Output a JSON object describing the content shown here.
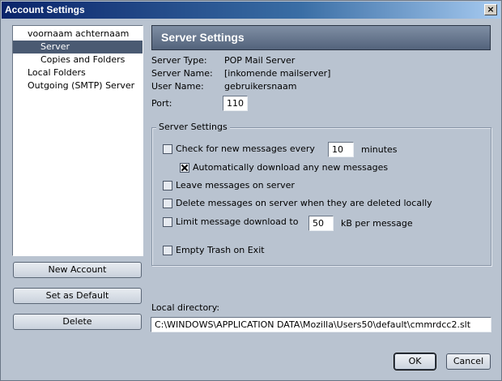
{
  "window": {
    "title": "Account Settings",
    "close_glyph": "×"
  },
  "tree": {
    "items": [
      {
        "label": "voornaam achternaam",
        "level": 0,
        "selected": false
      },
      {
        "label": "Server",
        "level": 1,
        "selected": true
      },
      {
        "label": "Copies and Folders",
        "level": 1,
        "selected": false
      },
      {
        "label": "Local Folders",
        "level": 0,
        "selected": false
      },
      {
        "label": "Outgoing (SMTP) Server",
        "level": 0,
        "selected": false
      }
    ]
  },
  "side_buttons": {
    "new_account": "New Account",
    "set_default": "Set as Default",
    "delete": "Delete"
  },
  "panel": {
    "title": "Server Settings",
    "server_type_label": "Server Type:",
    "server_type_value": "POP Mail Server",
    "server_name_label": "Server Name:",
    "server_name_value": "[inkomende mailserver]",
    "user_name_label": "User Name:",
    "user_name_value": "gebruikersnaam",
    "port_label": "Port:",
    "port_value": "110"
  },
  "group": {
    "title": "Server Settings",
    "check_new": {
      "label": "Check for new messages every",
      "checked": false,
      "value": "10",
      "suffix": "minutes"
    },
    "auto_download": {
      "label": "Automatically download any new messages",
      "checked": true
    },
    "leave_on_server": {
      "label": "Leave messages on server",
      "checked": false
    },
    "delete_on_server": {
      "label": "Delete messages on server when they are deleted locally",
      "checked": false
    },
    "limit_download": {
      "label": "Limit message download to",
      "checked": false,
      "value": "50",
      "suffix": "kB per message"
    },
    "empty_trash": {
      "label": "Empty Trash on Exit",
      "checked": false
    }
  },
  "local_directory": {
    "label": "Local directory:",
    "value": "C:\\WINDOWS\\APPLICATION DATA\\Mozilla\\Users50\\default\\cmmrdcc2.slt"
  },
  "dialog_buttons": {
    "ok": "OK",
    "cancel": "Cancel"
  },
  "colors": {
    "title_bar": "#0a246a",
    "window_bg": "#b9c3d0",
    "selection": "#4a5a72",
    "panel_header": "#53637b"
  }
}
